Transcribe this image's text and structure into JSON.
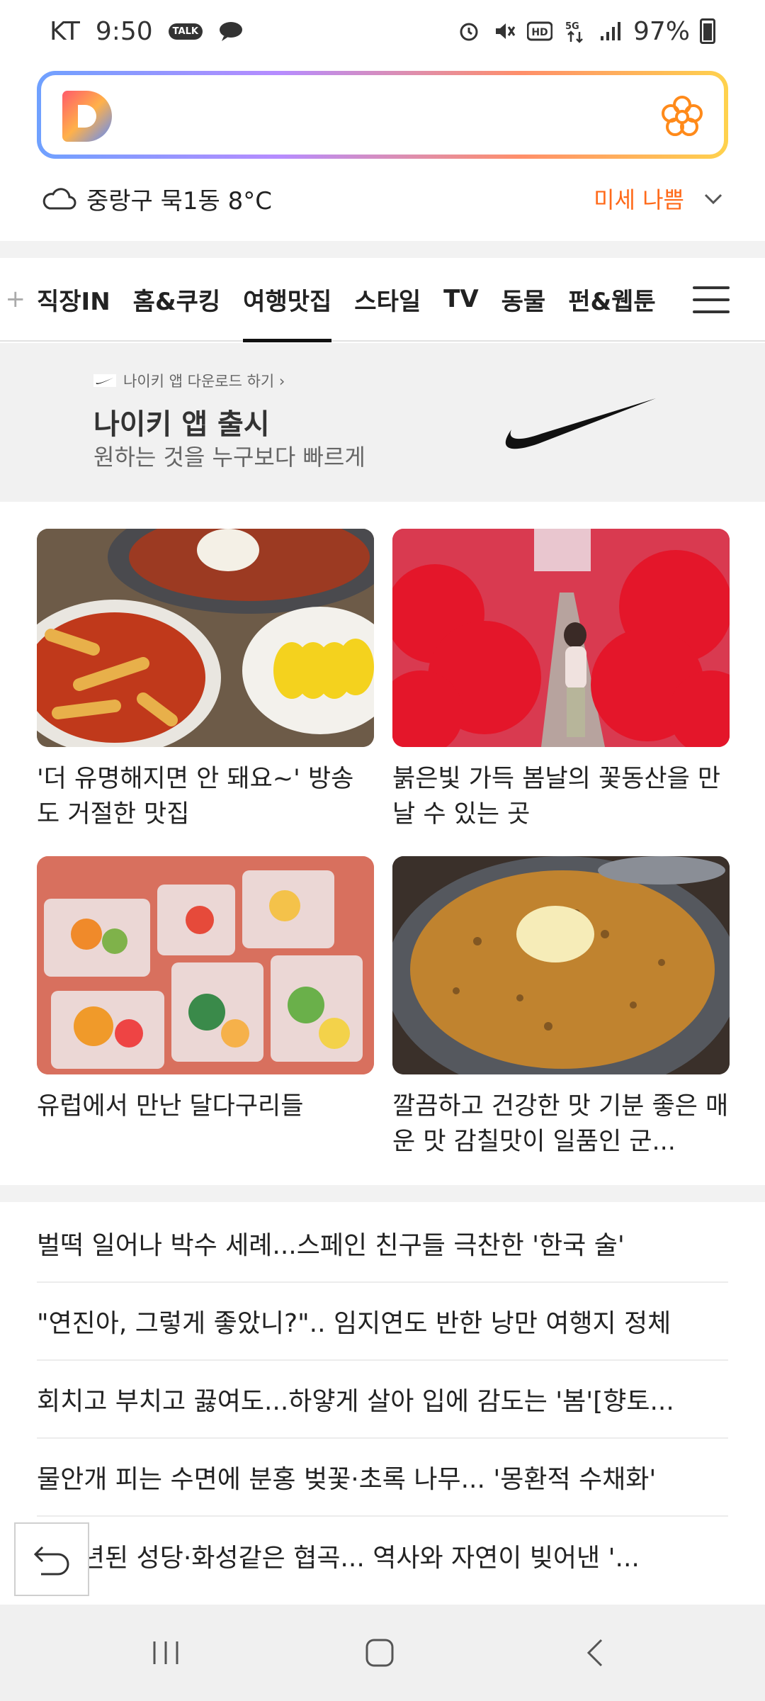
{
  "status_bar": {
    "carrier": "KT",
    "time": "9:50",
    "talk_badge": "TALK",
    "battery": "97%",
    "icons": [
      "talk-icon",
      "chat-icon",
      "alarm-icon",
      "mute-icon",
      "hd-icon",
      "5g-icon",
      "signal-icon",
      "battery-icon"
    ]
  },
  "search": {
    "logo_icon": "daum-logo",
    "flower_icon": "flower-icon"
  },
  "weather": {
    "location": "중랑구 묵1동 8°C",
    "dust": "미세 나쁨",
    "icon": "cloud-icon"
  },
  "tabs": [
    "직장IN",
    "홈&쿠킹",
    "여행맛집",
    "스타일",
    "TV",
    "동물",
    "펀&웹툰"
  ],
  "active_tab": "여행맛집",
  "ad": {
    "small_text": "나이키 앱 다운로드 하기 ›",
    "title": "나이키 앱 출시",
    "subtitle": "원하는 것을 누구보다 빠르게",
    "brand_color": "#111111"
  },
  "cards": [
    {
      "caption": "'더 유명해지면 안 돼요~' 방송도 거절한 맛집"
    },
    {
      "caption": "붉은빛 가득 봄날의 꽃동산을 만날 수 있는 곳"
    },
    {
      "caption": "유럽에서 만난 달다구리들"
    },
    {
      "caption": "깔끔하고 건강한 맛 기분 좋은 매운 맛 감칠맛이 일품인 군..."
    }
  ],
  "news": [
    "벌떡 일어나 박수 세례...스페인 친구들 극찬한 '한국 술'",
    "\"연진아, 그렇게 좋았니?\".. 임지연도 반한 낭만 여행지 정체",
    "회치고 부치고 끓여도...하얗게 살아 입에 감도는 '봄'[향토...",
    "물안개 피는 수면에 분홍 벚꽃·초록 나무... '몽환적 수채화'",
    "0년된 성당·화성같은 협곡... 역사와 자연이 빚어낸 '..."
  ],
  "colors": {
    "accent_orange": "#ff6a1a",
    "tab_active": "#111111"
  }
}
